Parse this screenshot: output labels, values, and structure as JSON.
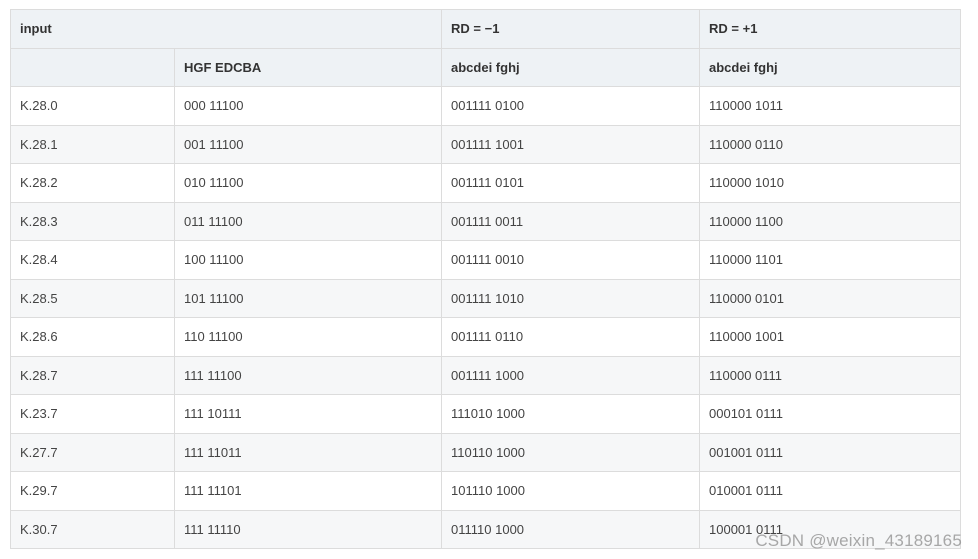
{
  "table": {
    "header_row1": [
      "input",
      "",
      "RD = −1",
      "RD = +1"
    ],
    "header_row2": [
      "",
      "HGF EDCBA",
      "abcdei fghj",
      "abcdei fghj"
    ],
    "rows": [
      [
        "K.28.0",
        "000 11100",
        "001111 0100",
        "110000 1011"
      ],
      [
        "K.28.1",
        "001 11100",
        "001111 1001",
        "110000 0110"
      ],
      [
        "K.28.2",
        "010 11100",
        "001111 0101",
        "110000 1010"
      ],
      [
        "K.28.3",
        "011 11100",
        "001111 0011",
        "110000 1100"
      ],
      [
        "K.28.4",
        "100 11100",
        "001111 0010",
        "110000 1101"
      ],
      [
        "K.28.5",
        "101 11100",
        "001111 1010",
        "110000 0101"
      ],
      [
        "K.28.6",
        "110 11100",
        "001111 0110",
        "110000 1001"
      ],
      [
        "K.28.7",
        "111 11100",
        "001111 1000",
        "110000 0111"
      ],
      [
        "K.23.7",
        "111 10111",
        "111010 1000",
        "000101 0111"
      ],
      [
        "K.27.7",
        "111 11011",
        "110110 1000",
        "001001 0111"
      ],
      [
        "K.29.7",
        "111 11101",
        "101110 1000",
        "010001 0111"
      ],
      [
        "K.30.7",
        "111 11110",
        "011110 1000",
        "100001 0111"
      ]
    ]
  },
  "watermark": "CSDN @weixin_43189165"
}
